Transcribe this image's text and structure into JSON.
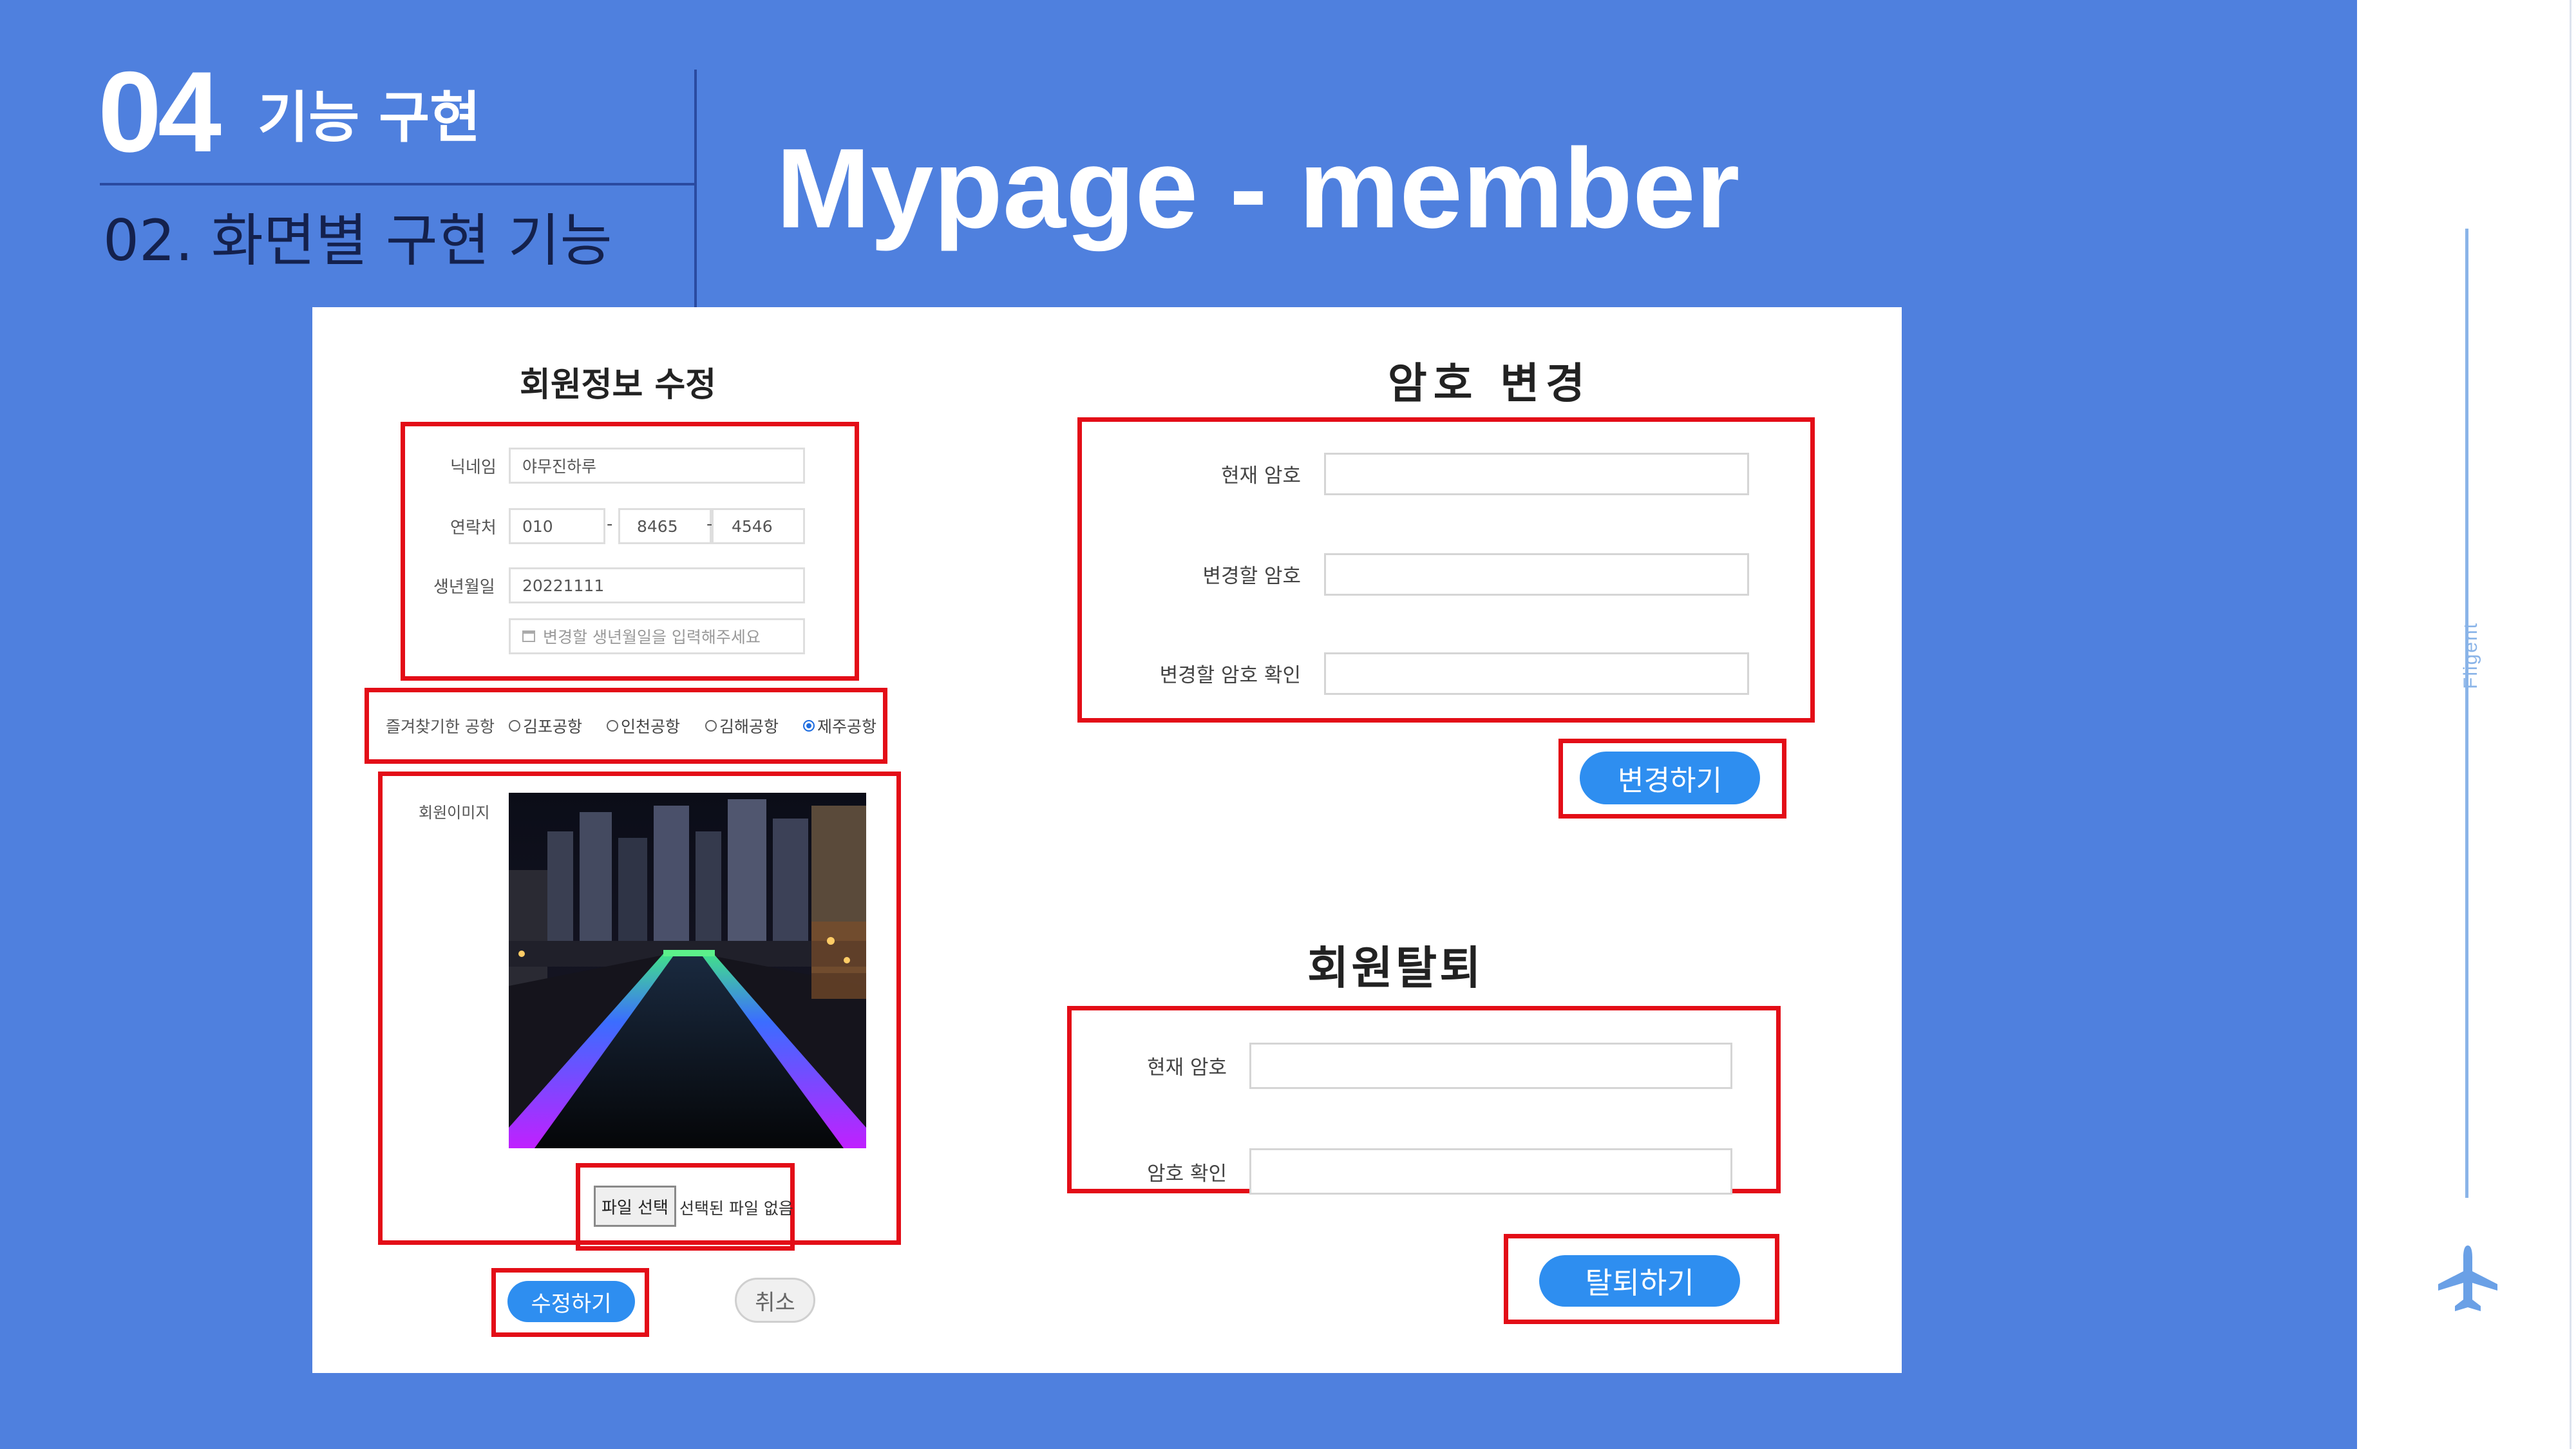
{
  "slide": {
    "section_number": "04",
    "section_title": "기능 구현",
    "subtitle": "02. 화면별 구현 기능",
    "main_title": "Mypage - member",
    "brand": "Fligent"
  },
  "member_edit": {
    "heading": "회원정보 수정",
    "nickname_label": "닉네임",
    "nickname_value": "야무진하루",
    "phone_label": "연락처",
    "phone_1": "010",
    "phone_2": "8465",
    "phone_3": "4546",
    "phone_sep": "-",
    "birth_label": "생년월일",
    "birth_value": "20221111",
    "birth_placeholder": "변경할 생년월일을 입력해주세요",
    "airport_label": "즐겨찾기한 공항",
    "airports": [
      {
        "label": "김포공항",
        "checked": false
      },
      {
        "label": "인천공항",
        "checked": false
      },
      {
        "label": "김해공항",
        "checked": false
      },
      {
        "label": "제주공항",
        "checked": true
      }
    ],
    "image_label": "회원이미지",
    "file_button": "파일 선택",
    "file_status": "선택된 파일 없음",
    "submit_button": "수정하기",
    "cancel_button": "취소"
  },
  "password_change": {
    "heading": "암호 변경",
    "current_label": "현재 암호",
    "new_label": "변경할 암호",
    "confirm_label": "변경할 암호 확인",
    "submit_button": "변경하기"
  },
  "withdraw": {
    "heading": "회원탈퇴",
    "current_label": "현재 암호",
    "confirm_label": "암호 확인",
    "submit_button": "탈퇴하기"
  },
  "colors": {
    "slide_bg": "#4f80de",
    "highlight": "#e30d17",
    "button_blue": "#2e8ef0"
  }
}
